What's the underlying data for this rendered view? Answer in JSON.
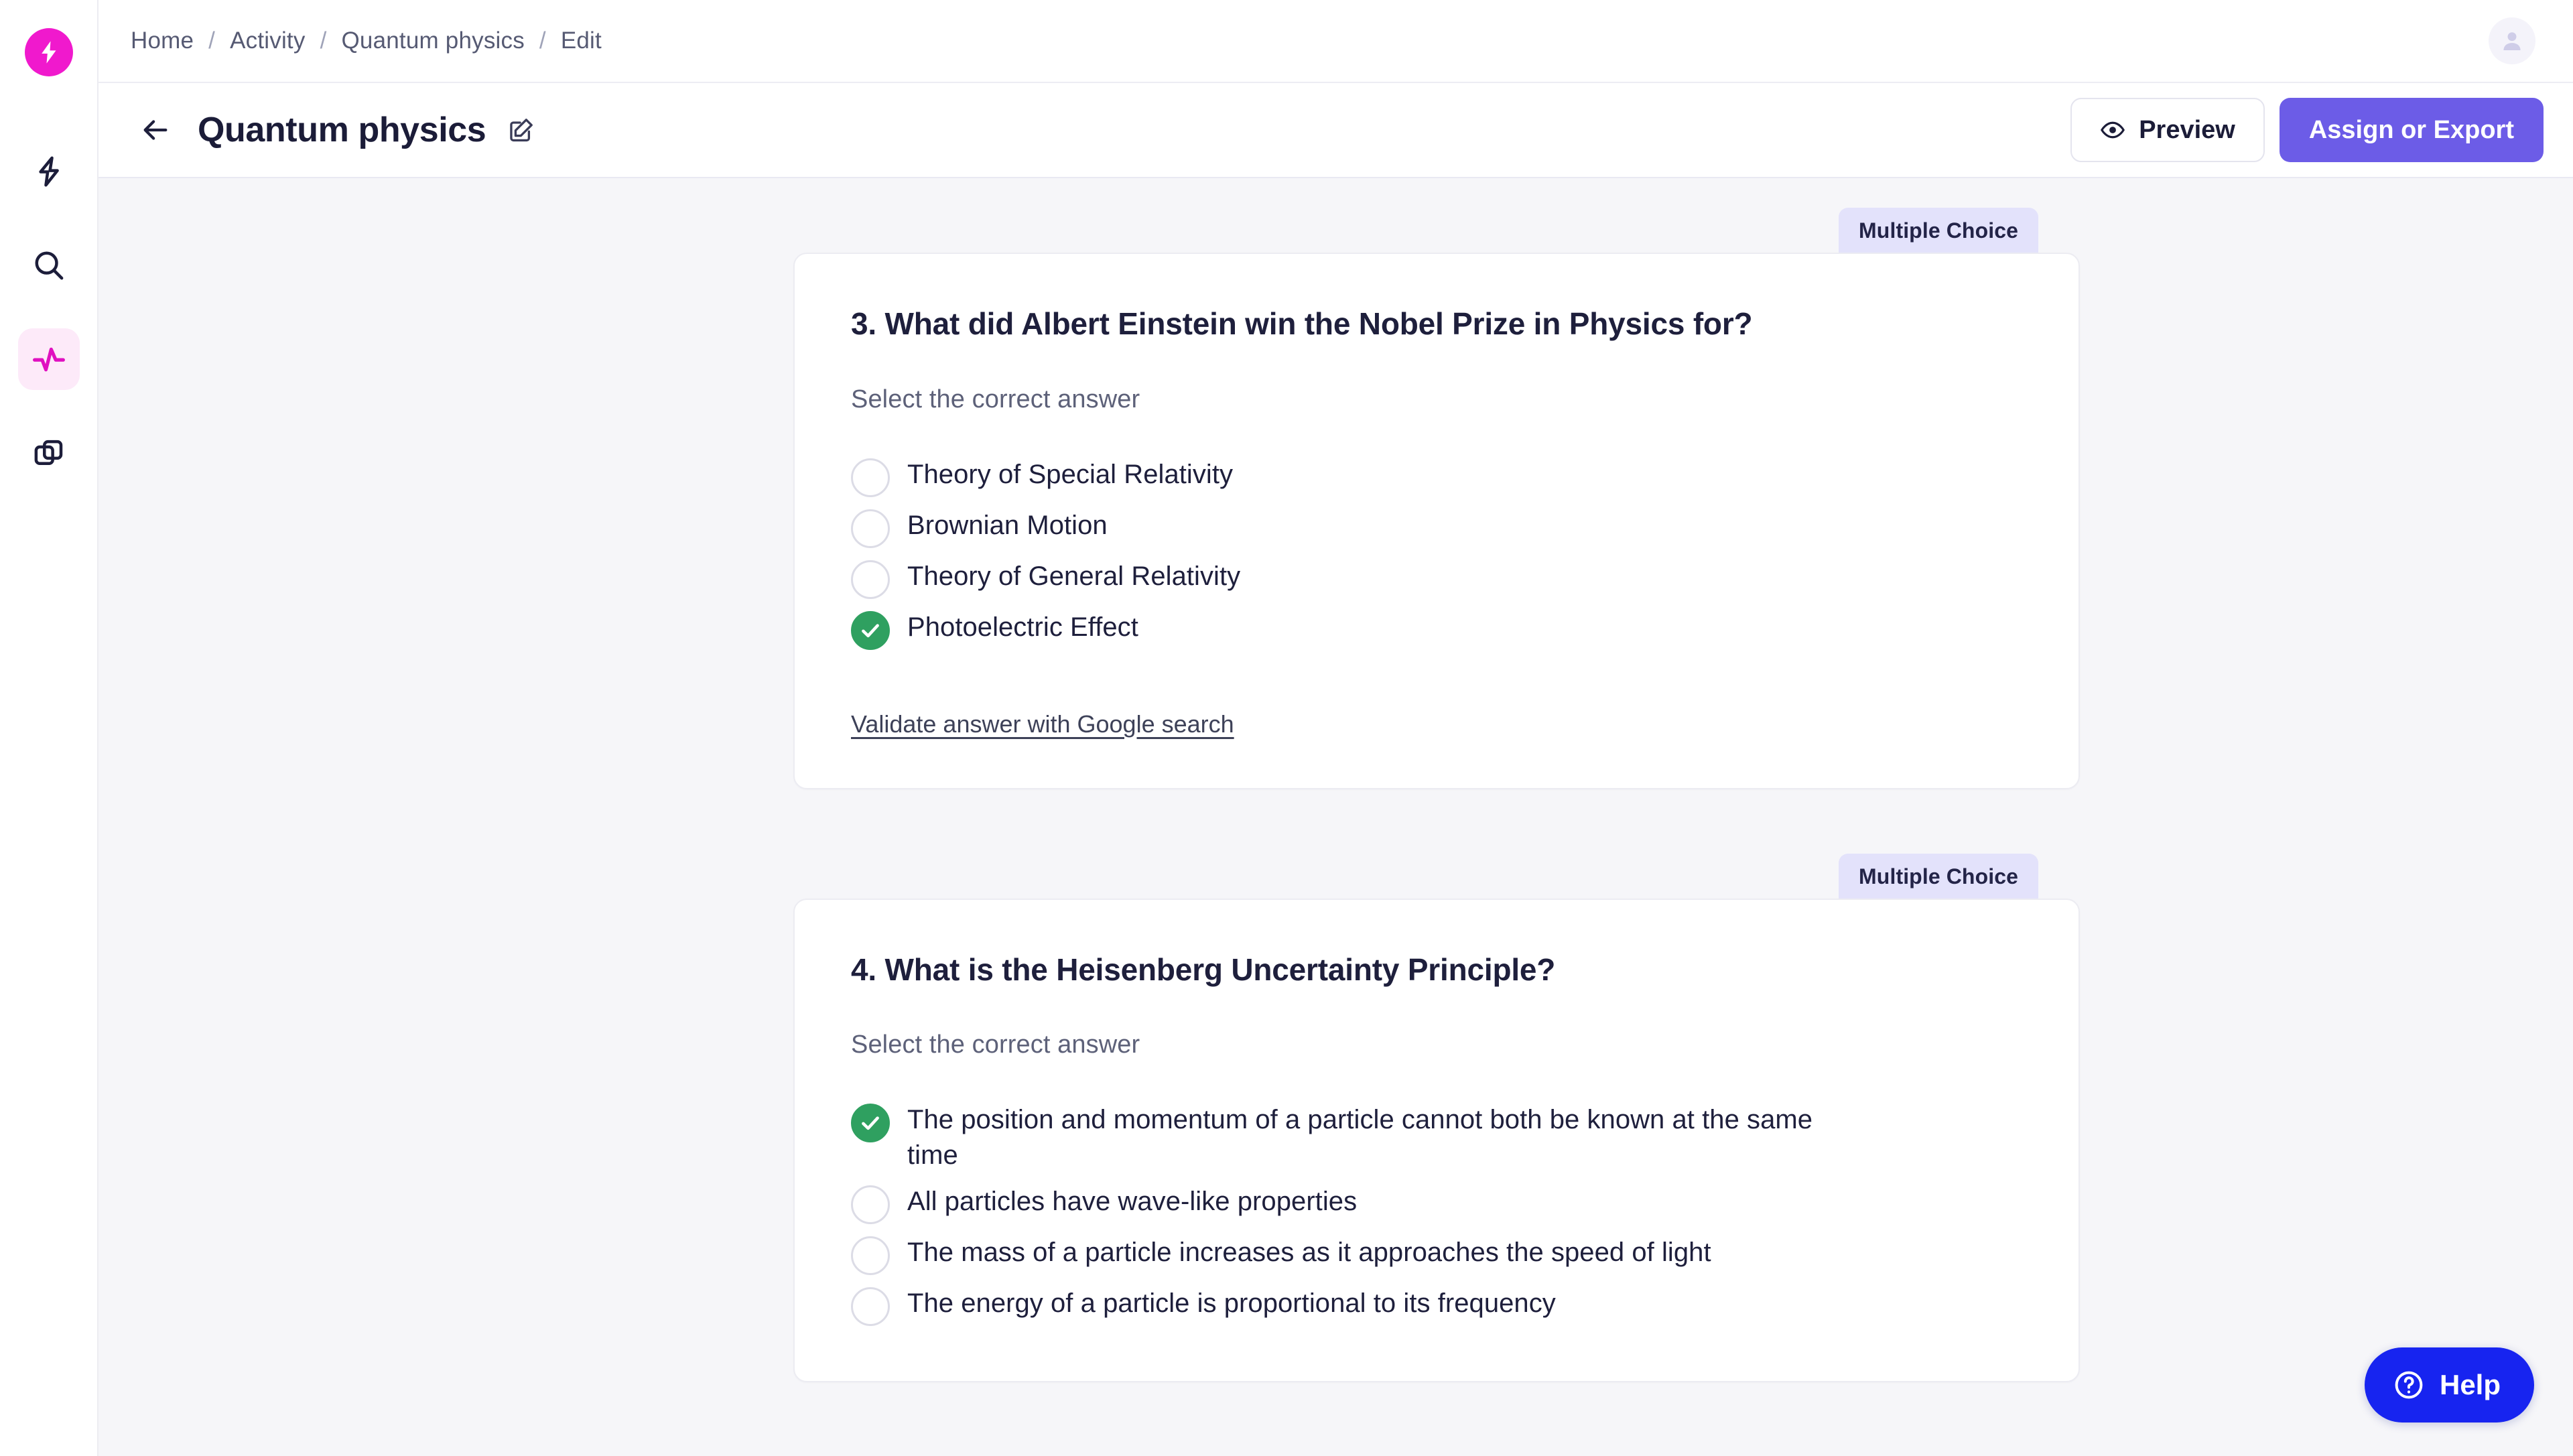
{
  "brand": {
    "logo_icon": "lightning-bolt-logo",
    "color": "#f019cd"
  },
  "sidebar": {
    "items": [
      {
        "icon": "lightning-bolt-icon",
        "name": "generate",
        "active": false
      },
      {
        "icon": "search-icon",
        "name": "search",
        "active": false
      },
      {
        "icon": "activity-pulse-icon",
        "name": "activity",
        "active": true
      },
      {
        "icon": "layers-copy-icon",
        "name": "library",
        "active": false
      }
    ],
    "active_bg": "#fdeaf9",
    "active_color": "#e010c0"
  },
  "breadcrumb": {
    "items": [
      "Home",
      "Activity",
      "Quantum physics",
      "Edit"
    ],
    "separator": "/"
  },
  "account": {
    "avatar_icon": "user-avatar-icon"
  },
  "titlebar": {
    "back_icon": "arrow-left-icon",
    "title": "Quantum physics",
    "edit_icon": "edit-square-icon",
    "preview_label": "Preview",
    "preview_icon": "eye-icon",
    "assign_label": "Assign or Export",
    "assign_color": "#6c5ce7"
  },
  "questions": [
    {
      "badge": "Multiple Choice",
      "title": "3. What did Albert Einstein win the Nobel Prize in Physics for?",
      "instruction": "Select the correct answer",
      "options": [
        {
          "label": "Theory of Special Relativity",
          "correct": false
        },
        {
          "label": "Brownian Motion",
          "correct": false
        },
        {
          "label": "Theory of General Relativity",
          "correct": false
        },
        {
          "label": "Photoelectric Effect",
          "correct": true
        }
      ],
      "validate_label": "Validate answer with Google search"
    },
    {
      "badge": "Multiple Choice",
      "title": "4. What is the Heisenberg Uncertainty Principle?",
      "instruction": "Select the correct answer",
      "options": [
        {
          "label": "The position and momentum of a particle cannot both be known at the same time",
          "correct": true
        },
        {
          "label": "All particles have wave-like properties",
          "correct": false
        },
        {
          "label": "The mass of a particle increases as it approaches the speed of light",
          "correct": false
        },
        {
          "label": "The energy of a particle is proportional to its frequency",
          "correct": false
        }
      ],
      "validate_label": ""
    }
  ],
  "help": {
    "label": "Help",
    "icon": "question-circle-icon",
    "color": "#1724f0"
  },
  "colors": {
    "correct_green": "#2fa060",
    "badge_bg": "#e3e2fb",
    "content_bg": "#f6f6f9",
    "text_dark": "#1e1f3c"
  }
}
